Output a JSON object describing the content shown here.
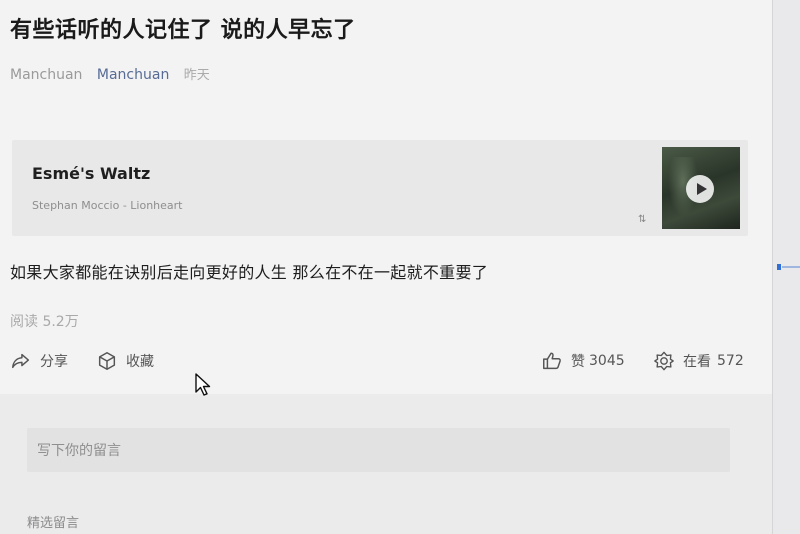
{
  "article": {
    "title": "有些话听的人记住了 说的人早忘了",
    "author": "Manchuan",
    "account": "Manchuan",
    "time": "昨天",
    "body": "如果大家都能在诀别后走向更好的人生 那么在不在一起就不重要了",
    "reads": "阅读 5.2万"
  },
  "music": {
    "title": "Esmé's Waltz",
    "artist": "Stephan Moccio - Lionheart"
  },
  "actions": {
    "share": "分享",
    "favorite": "收藏",
    "like_label": "赞",
    "like_count": "3045",
    "watch_label": "在看",
    "watch_count": "572"
  },
  "comments": {
    "placeholder": "写下你的留言",
    "featured_label": "精选留言"
  },
  "colors": {
    "link": "#576b95",
    "scroll_accent": "#2f6fd6"
  }
}
